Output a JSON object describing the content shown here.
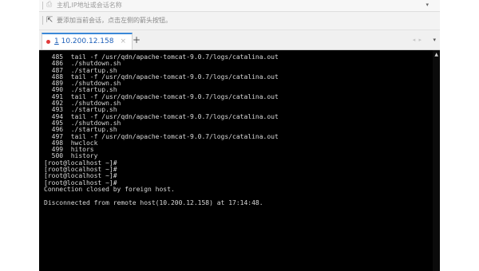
{
  "hostbar": {
    "placeholder": "主机,IP地址或会话名称",
    "icon": "bookmark-icon",
    "dropdown_icon": "▾"
  },
  "hint": {
    "text": "要添加当前会话，点击左侧的箭头按钮。",
    "icon": "add-session-arrow-icon"
  },
  "tabs": [
    {
      "number": "1",
      "title": "10.200.12.158",
      "status_color": "#e23b3b",
      "close_label": "×"
    }
  ],
  "tab_controls": {
    "new_tab_label": "+",
    "nav_arrows": "◂ ▸",
    "menu_label": "▾"
  },
  "terminal": {
    "lines": [
      "  485  tail -f /usr/qdn/apache-tomcat-9.0.7/logs/catalina.out",
      "  486  ./shutdown.sh",
      "  487  ./startup.sh",
      "  488  tail -f /usr/qdn/apache-tomcat-9.0.7/logs/catalina.out",
      "  489  ./shutdown.sh",
      "  490  ./startup.sh",
      "  491  tail -f /usr/qdn/apache-tomcat-9.0.7/logs/catalina.out",
      "  492  ./shutdown.sh",
      "  493  ./startup.sh",
      "  494  tail -f /usr/qdn/apache-tomcat-9.0.7/logs/catalina.out",
      "  495  ./shutdown.sh",
      "  496  ./startup.sh",
      "  497  tail -f /usr/qdn/apache-tomcat-9.0.7/logs/catalina.out",
      "  498  hwclock",
      "  499  hitors",
      "  500  history",
      "[root@localhost ~]#",
      "[root@localhost ~]#",
      "[root@localhost ~]#",
      "[root@localhost ~]#",
      "Connection closed by foreign host.",
      "",
      "Disconnected from remote host(10.200.12.158) at 17:14:48."
    ],
    "scroll_up_icon": "▲"
  }
}
